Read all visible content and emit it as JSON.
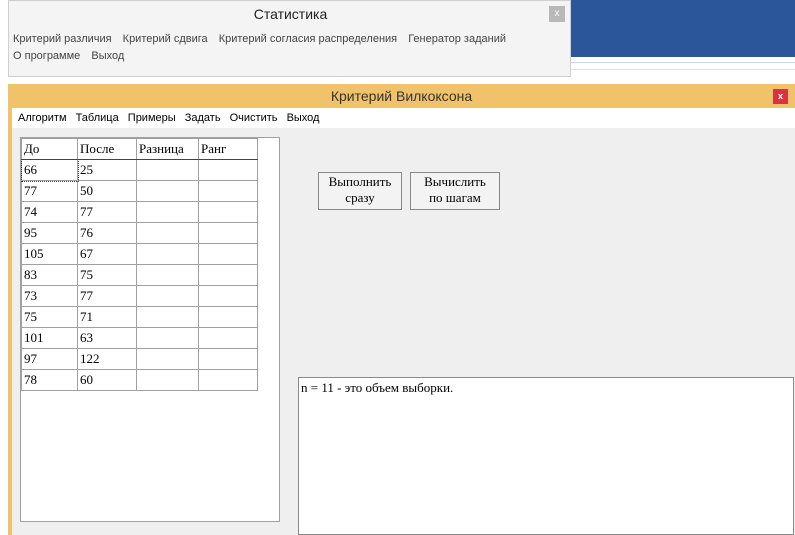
{
  "background_window": {
    "title": "Статистика",
    "close_glyph": "x",
    "menu": [
      "Критерий различия",
      "Критерий сдвига",
      "Критерий согласия распределения",
      "Генератор заданий",
      "О программе",
      "Выход"
    ]
  },
  "main_window": {
    "title": "Критерий Вилкоксона",
    "close_glyph": "x",
    "menu": [
      "Алгоритм",
      "Таблица",
      "Примеры",
      "Задать",
      "Очистить",
      "Выход"
    ],
    "table": {
      "headers": [
        "До",
        "После",
        "Разница",
        "Ранг"
      ],
      "rows": [
        [
          "66",
          "25",
          "",
          ""
        ],
        [
          "77",
          "50",
          "",
          ""
        ],
        [
          "74",
          "77",
          "",
          ""
        ],
        [
          "95",
          "76",
          "",
          ""
        ],
        [
          "105",
          "67",
          "",
          ""
        ],
        [
          "83",
          "75",
          "",
          ""
        ],
        [
          "73",
          "77",
          "",
          ""
        ],
        [
          "75",
          "71",
          "",
          ""
        ],
        [
          "101",
          "63",
          "",
          ""
        ],
        [
          "97",
          "122",
          "",
          ""
        ],
        [
          "78",
          "60",
          "",
          ""
        ]
      ]
    },
    "buttons": {
      "run_now": [
        "Выполнить",
        "сразу"
      ],
      "step_by_step": [
        "Вычислить",
        "по шагам"
      ]
    },
    "output_text": "n = 11 - это объем выборки."
  },
  "colors": {
    "title_bar": "#f0c36b",
    "close_button": "#d9333f",
    "desktop_blue": "#2b579a"
  }
}
